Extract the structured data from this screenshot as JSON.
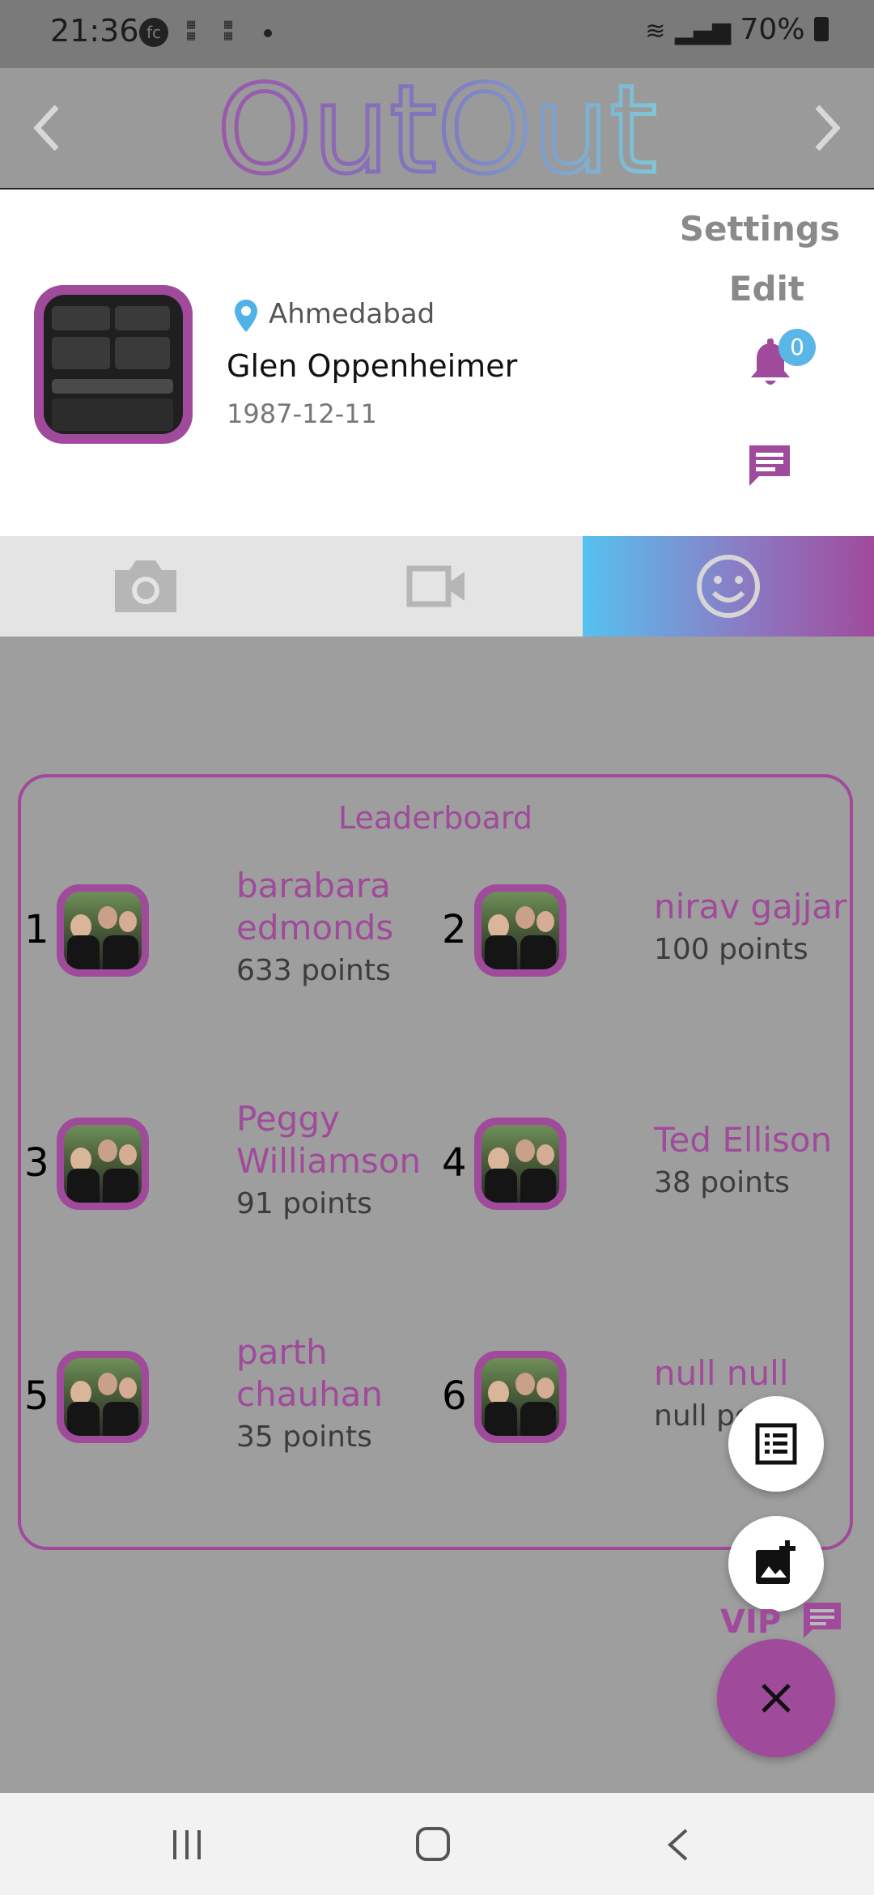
{
  "status_bar": {
    "time": "21:36",
    "battery": "70%"
  },
  "header": {
    "logo_text": "OutOut"
  },
  "profile": {
    "location": "Ahmedabad",
    "name": "Glen Oppenheimer",
    "dob": "1987-12-11",
    "settings_label": "Settings",
    "edit_label": "Edit",
    "notification_count": "0"
  },
  "tabs": [
    {
      "icon": "camera-icon"
    },
    {
      "icon": "video-icon"
    },
    {
      "icon": "emoji-icon",
      "selected": true
    }
  ],
  "leaderboard": {
    "title": "Leaderboard",
    "entries": [
      {
        "rank": "1",
        "name_line1": "barabara",
        "name_line2": "edmonds",
        "points": "633 points"
      },
      {
        "rank": "2",
        "name_line1": "nirav gajjar",
        "name_line2": "",
        "points": "100 points"
      },
      {
        "rank": "3",
        "name_line1": "Peggy",
        "name_line2": "Williamson",
        "points": "91 points"
      },
      {
        "rank": "4",
        "name_line1": "Ted Ellison",
        "name_line2": "",
        "points": "38 points"
      },
      {
        "rank": "5",
        "name_line1": "parth",
        "name_line2": "chauhan",
        "points": "35 points"
      },
      {
        "rank": "6",
        "name_line1": "null null",
        "name_line2": "",
        "points": "null points"
      }
    ]
  },
  "fab": {
    "vip_label": "VIP"
  },
  "colors": {
    "accent": "#a04a9b",
    "blue": "#56c2f0"
  }
}
